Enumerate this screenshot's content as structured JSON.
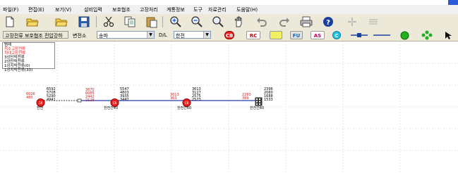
{
  "menu": {
    "items": [
      "파일(F)",
      "편집(E)",
      "보기(V)",
      "설비입력",
      "보호협조",
      "고장처리",
      "계통정보",
      "도구",
      "자료관리",
      "도움말(H)"
    ]
  },
  "toolbar": {
    "icons": [
      "new-file-icon",
      "open-folder-icon",
      "open-folder-icon",
      "save-icon",
      "cut-icon",
      "copy-icon",
      "paste-icon",
      "zoom-in-icon",
      "zoom-out-icon",
      "zoom-fit-icon",
      "pan-hand-icon",
      "undo-icon",
      "redo-icon",
      "print-icon",
      "help-icon",
      "settings-icon",
      "grid-icon"
    ]
  },
  "options": {
    "mode_button": "고장전류 보호협조 전압강하",
    "substation_label": "변전소",
    "substation_value": "송파",
    "dl_label": "D/L",
    "dl_value": "한전",
    "buttons": [
      {
        "label": "CB",
        "color": "#e82020",
        "text": "#ffffff",
        "shape": "circle"
      },
      {
        "label": "RC",
        "color": "#ffffff",
        "text": "#d00000",
        "shape": "box"
      },
      {
        "label": "",
        "color": "#f0f060",
        "text": "#000000",
        "shape": "box"
      },
      {
        "label": "FU",
        "color": "#e0e0e0",
        "text": "#1060c0",
        "shape": "box"
      },
      {
        "label": "AS",
        "color": "#ffffff",
        "text": "#c00060",
        "shape": "box"
      },
      {
        "label": "C",
        "color": "#20c0e0",
        "text": "#ffffff",
        "shape": "circle"
      }
    ]
  },
  "legend": {
    "title": "범례",
    "lines": [
      {
        "text": "최소고장전류",
        "color": "#e02020"
      },
      {
        "text": "최대고장전류",
        "color": "#e02020"
      },
      {
        "text": "3상단락전류",
        "color": "#000000"
      },
      {
        "text": "2상단락전류",
        "color": "#000000"
      },
      {
        "text": "1상지락전류(0)",
        "color": "#000000"
      },
      {
        "text": "1상지락전류(30)",
        "color": "#000000"
      }
    ]
  },
  "diagram": {
    "nodes": [
      {
        "id": "n1",
        "label": "한전",
        "type": "cb",
        "left_values": [
          "6026",
          "480"
        ],
        "right_values": [
          "6592",
          "5708",
          "5290",
          "4941",
          "5290"
        ]
      },
      {
        "id": "n2",
        "label": "한전간40",
        "type": "cb",
        "left_values": [
          "3670",
          "6085",
          "2442",
          "2128"
        ],
        "right_values": [
          "5547",
          "4803",
          "3935",
          "3447"
        ]
      },
      {
        "id": "n3",
        "label": "한전간60",
        "type": "cb",
        "left_values": [
          "3613",
          "363"
        ],
        "right_values": [
          "3613",
          "3127",
          "2575",
          "2573"
        ]
      },
      {
        "id": "n4",
        "label": "한전간80",
        "type": "building",
        "left_values": [
          "2260",
          "389"
        ],
        "right_values": [
          "2396",
          "2060",
          "1688",
          "1533"
        ]
      }
    ]
  }
}
